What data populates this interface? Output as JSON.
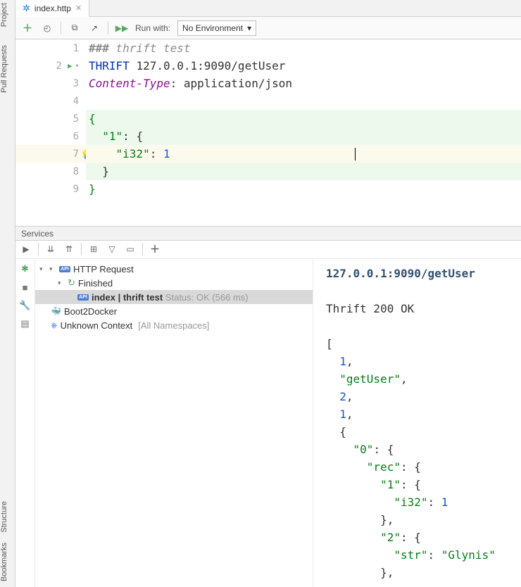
{
  "tabs": {
    "file": "index.http"
  },
  "toolbar": {
    "run_with_label": "Run with:",
    "env_selected": "No Environment"
  },
  "editor": {
    "lines": [
      {
        "n": "1",
        "tokens": [
          {
            "cls": "cmt cmt-bold",
            "t": "### "
          },
          {
            "cls": "cmt",
            "t": "thrift test"
          }
        ]
      },
      {
        "n": "2",
        "run": true,
        "tokens": [
          {
            "cls": "kw",
            "t": "THRIFT "
          },
          {
            "cls": "txt",
            "t": "127.0.0.1:9090/getUser"
          }
        ]
      },
      {
        "n": "3",
        "tokens": [
          {
            "cls": "hdr",
            "t": "Content-Type"
          },
          {
            "cls": "txt",
            "t": ": application/json"
          }
        ]
      },
      {
        "n": "4",
        "tokens": []
      },
      {
        "n": "5",
        "hl": "g",
        "tokens": [
          {
            "cls": "brace-g",
            "t": "{"
          }
        ]
      },
      {
        "n": "6",
        "hl": "g",
        "tokens": [
          {
            "cls": "txt",
            "t": "  "
          },
          {
            "cls": "str",
            "t": "\"1\""
          },
          {
            "cls": "txt",
            "t": ": {"
          }
        ]
      },
      {
        "n": "7",
        "hl": "y",
        "bulb": true,
        "tokens": [
          {
            "cls": "txt",
            "t": "    "
          },
          {
            "cls": "str",
            "t": "\"i32\""
          },
          {
            "cls": "txt",
            "t": ": "
          },
          {
            "cls": "num",
            "t": "1"
          }
        ],
        "caret": true
      },
      {
        "n": "8",
        "hl": "g",
        "tokens": [
          {
            "cls": "txt",
            "t": "  }"
          }
        ]
      },
      {
        "n": "9",
        "tokens": [
          {
            "cls": "brace-g",
            "t": "}"
          }
        ]
      }
    ]
  },
  "services": {
    "title": "Services",
    "tree": {
      "root": "HTTP Request",
      "finished": "Finished",
      "item_file": "index",
      "item_sep": "  |  ",
      "item_name": "thrift test",
      "item_status": "Status: OK (566 ms)",
      "docker": "Boot2Docker",
      "kube": "Unknown Context",
      "kube_extra": "[All Namespaces]"
    },
    "response": {
      "title": "127.0.0.1:9090/getUser",
      "status": "Thrift 200 OK",
      "lines": [
        [
          {
            "cls": "txt",
            "t": "["
          }
        ],
        [
          {
            "cls": "txt",
            "t": "  "
          },
          {
            "cls": "num",
            "t": "1"
          },
          {
            "cls": "txt",
            "t": ","
          }
        ],
        [
          {
            "cls": "txt",
            "t": "  "
          },
          {
            "cls": "str",
            "t": "\"getUser\""
          },
          {
            "cls": "txt",
            "t": ","
          }
        ],
        [
          {
            "cls": "txt",
            "t": "  "
          },
          {
            "cls": "num",
            "t": "2"
          },
          {
            "cls": "txt",
            "t": ","
          }
        ],
        [
          {
            "cls": "txt",
            "t": "  "
          },
          {
            "cls": "num",
            "t": "1"
          },
          {
            "cls": "txt",
            "t": ","
          }
        ],
        [
          {
            "cls": "txt",
            "t": "  {"
          }
        ],
        [
          {
            "cls": "txt",
            "t": "    "
          },
          {
            "cls": "str",
            "t": "\"0\""
          },
          {
            "cls": "txt",
            "t": ": {"
          }
        ],
        [
          {
            "cls": "txt",
            "t": "      "
          },
          {
            "cls": "str",
            "t": "\"rec\""
          },
          {
            "cls": "txt",
            "t": ": {"
          }
        ],
        [
          {
            "cls": "txt",
            "t": "        "
          },
          {
            "cls": "str",
            "t": "\"1\""
          },
          {
            "cls": "txt",
            "t": ": {"
          }
        ],
        [
          {
            "cls": "txt",
            "t": "          "
          },
          {
            "cls": "str",
            "t": "\"i32\""
          },
          {
            "cls": "txt",
            "t": ": "
          },
          {
            "cls": "num",
            "t": "1"
          }
        ],
        [
          {
            "cls": "txt",
            "t": "        },"
          }
        ],
        [
          {
            "cls": "txt",
            "t": "        "
          },
          {
            "cls": "str",
            "t": "\"2\""
          },
          {
            "cls": "txt",
            "t": ": {"
          }
        ],
        [
          {
            "cls": "txt",
            "t": "          "
          },
          {
            "cls": "str",
            "t": "\"str\""
          },
          {
            "cls": "txt",
            "t": ": "
          },
          {
            "cls": "str",
            "t": "\"Glynis\""
          }
        ],
        [
          {
            "cls": "txt",
            "t": "        },"
          }
        ]
      ]
    }
  },
  "rails": {
    "project": "Project",
    "pull": "Pull Requests",
    "structure": "Structure",
    "bookmarks": "Bookmarks"
  }
}
